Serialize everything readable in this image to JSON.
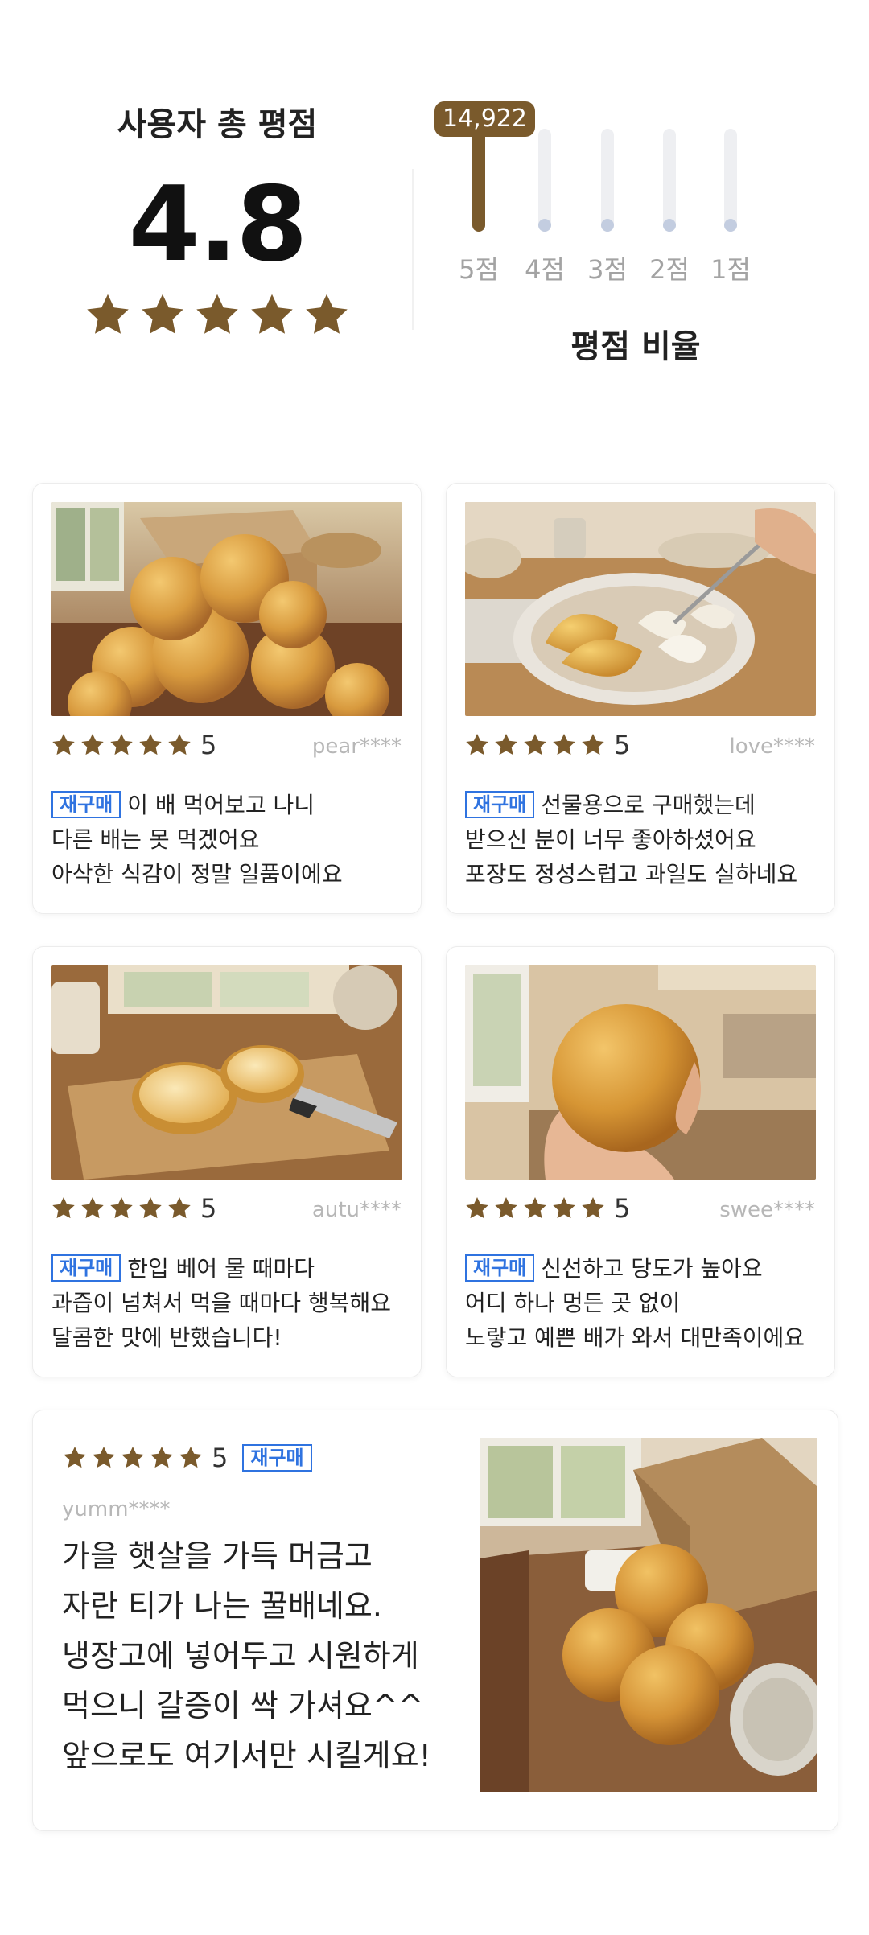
{
  "summary": {
    "title": "사용자 총 평점",
    "score": "4.8",
    "stars": 5,
    "star_color": "#7a5a2c",
    "distribution_title": "평점 비율",
    "distribution": [
      {
        "label": "5점",
        "count": "14,922",
        "ratio": 1.0
      },
      {
        "label": "4점",
        "ratio": 0.0
      },
      {
        "label": "3점",
        "ratio": 0.0
      },
      {
        "label": "2점",
        "ratio": 0.0
      },
      {
        "label": "1점",
        "ratio": 0.0
      }
    ]
  },
  "reviews": [
    {
      "rating": "5",
      "user": "pear****",
      "badge": "재구매",
      "lines": [
        "이 배 먹어보고 나니",
        "다른 배는 못 먹겠어요",
        "아삭한 식감이 정말 일품이에요"
      ],
      "photo": "pears-pile-with-box"
    },
    {
      "rating": "5",
      "user": "love****",
      "badge": "재구매",
      "lines": [
        "선물용으로 구매했는데",
        "받으신 분이 너무 좋아하셨어요",
        "포장도 정성스럽고 과일도 실하네요"
      ],
      "photo": "sliced-pear-plate-fork"
    },
    {
      "rating": "5",
      "user": "autu****",
      "badge": "재구매",
      "lines": [
        "한입 베어 물 때마다",
        "과즙이 넘쳐서 먹을 때마다 행복해요",
        "달콤한 맛에 반했습니다!"
      ],
      "photo": "cut-pear-cutting-board"
    },
    {
      "rating": "5",
      "user": "swee****",
      "badge": "재구매",
      "lines": [
        "신선하고 당도가 높아요",
        "어디 하나 멍든 곳 없이",
        "노랗고 예쁜 배가 와서 대만족이에요"
      ],
      "photo": "hand-holding-pear"
    }
  ],
  "featured_review": {
    "rating": "5",
    "badge": "재구매",
    "user": "yumm****",
    "lines": [
      "가을 햇살을 가득 머금고",
      "자란 티가 나는 꿀배네요.",
      "냉장고에 넣어두고 시원하게",
      "먹으니 갈증이 싹 가셔요^^",
      "앞으로도 여기서만 시킬게요!"
    ],
    "photo": "pears-on-table-with-box"
  },
  "colors": {
    "accent_brown": "#7a5a2c",
    "badge_blue": "#2f73e0",
    "muted_gray": "#b7b7b7",
    "track_gray": "#eeeff2",
    "dot_blue_gray": "#c3cde0"
  }
}
